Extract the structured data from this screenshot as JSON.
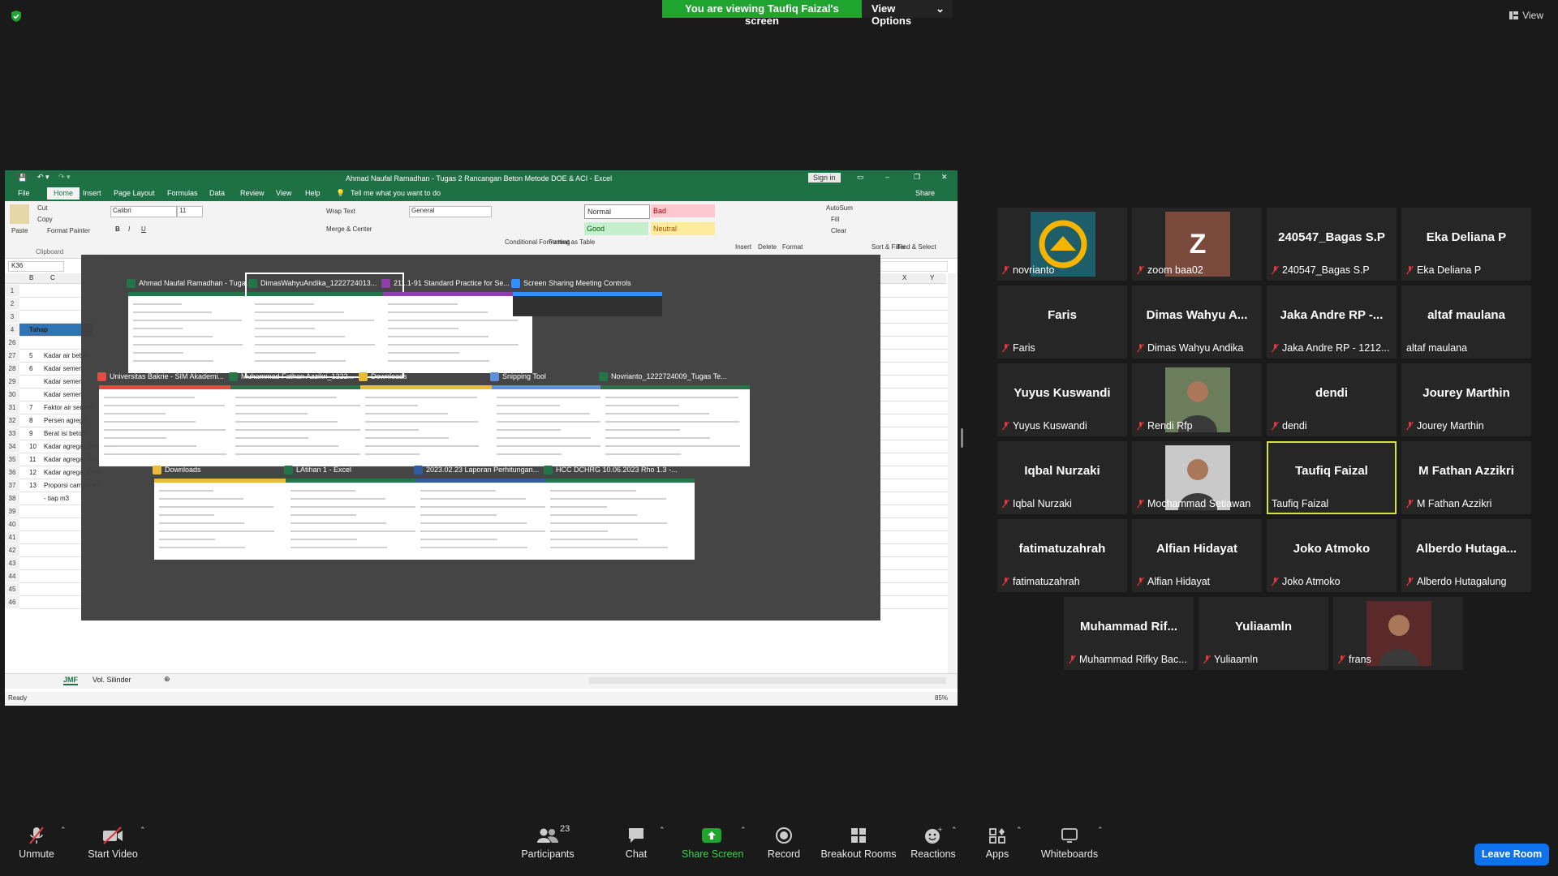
{
  "banner": {
    "viewing": "You are viewing Taufiq Faizal's screen",
    "options": "View Options"
  },
  "view_button": "View",
  "excel": {
    "title": "Ahmad Naufal Ramadhan - Tugas 2 Rancangan Beton Metode DOE & ACI  -  Excel",
    "sign_in": "Sign in",
    "share": "Share",
    "tabs": [
      "File",
      "Home",
      "Insert",
      "Page Layout",
      "Formulas",
      "Data",
      "Review",
      "View",
      "Help"
    ],
    "tell_me": "Tell me what you want to do",
    "ribbon": {
      "paste": "Paste",
      "cut": "Cut",
      "copy": "Copy",
      "format_painter": "Format Painter",
      "clipboard": "Clipboard",
      "font": "Calibri",
      "size": "11",
      "wrap_text": "Wrap Text",
      "merge_center": "Merge & Center",
      "number_format": "General",
      "cond_format": "Conditional Formatting",
      "format_table": "Format as Table",
      "style_normal": "Normal",
      "style_bad": "Bad",
      "style_good": "Good",
      "style_neutral": "Neutral",
      "insert": "Insert",
      "delete": "Delete",
      "format": "Format",
      "autosum": "AutoSum",
      "fill": "Fill",
      "clear": "Clear",
      "sort_filter": "Sort & Filter",
      "find_select": "Find & Select"
    },
    "name_box": "K36",
    "columns": [
      "B",
      "C",
      "X",
      "Y"
    ],
    "rows": [
      {
        "n": "1",
        "b": "",
        "c": ""
      },
      {
        "n": "2",
        "b": "",
        "c": ""
      },
      {
        "n": "3",
        "b": "",
        "c": ""
      },
      {
        "n": "4",
        "b": "Tahap",
        "c": ""
      },
      {
        "n": "26",
        "b": "",
        "c": ""
      },
      {
        "n": "27",
        "b": "5",
        "c": "Kadar air bebas"
      },
      {
        "n": "28",
        "b": "6",
        "c": "Kadar semen"
      },
      {
        "n": "29",
        "b": "",
        "c": "Kadar semen"
      },
      {
        "n": "30",
        "b": "",
        "c": "Kadar semen"
      },
      {
        "n": "31",
        "b": "7",
        "c": "Faktor air semen"
      },
      {
        "n": "32",
        "b": "8",
        "c": "Persen agregat"
      },
      {
        "n": "33",
        "b": "9",
        "c": "Berat isi beton"
      },
      {
        "n": "34",
        "b": "10",
        "c": "Kadar agregat gabungan"
      },
      {
        "n": "35",
        "b": "11",
        "c": "Kadar agregat halus"
      },
      {
        "n": "36",
        "b": "12",
        "c": "Kadar agregat kasar"
      },
      {
        "n": "37",
        "b": "13",
        "c": "Proporsi campuran"
      },
      {
        "n": "38",
        "b": "",
        "c": "- tiap m3"
      },
      {
        "n": "39",
        "b": "",
        "c": ""
      },
      {
        "n": "40",
        "b": "",
        "c": ""
      },
      {
        "n": "41",
        "b": "",
        "c": ""
      },
      {
        "n": "42",
        "b": "",
        "c": ""
      },
      {
        "n": "43",
        "b": "",
        "c": ""
      },
      {
        "n": "44",
        "b": "",
        "c": ""
      },
      {
        "n": "45",
        "b": "",
        "c": ""
      },
      {
        "n": "46",
        "b": "",
        "c": ""
      }
    ],
    "sheet_tabs": [
      "JMF",
      "Vol. Silinder"
    ],
    "status": "Ready",
    "zoom": "85%"
  },
  "switcher": [
    {
      "label": "Ahmad Naufal Ramadhan - Tuga...",
      "icon": "excel-icon",
      "color": "#1e7145"
    },
    {
      "label": "DimasWahyuAndika_1222724013...",
      "icon": "excel-icon",
      "color": "#1e7145"
    },
    {
      "label": "211.1-91 Standard Practice for Se...",
      "icon": "pdf-icon",
      "color": "#8a3aa8"
    },
    {
      "label": "Screen Sharing Meeting Controls",
      "icon": "zoom-icon",
      "color": "#2d8cff"
    },
    {
      "label": "Universitas Bakrie - SIM Akademi...",
      "icon": "chrome-icon",
      "color": "#e8453c"
    },
    {
      "label": "Muhammad Fathan Azzikri_1222...",
      "icon": "excel-icon",
      "color": "#1e7145"
    },
    {
      "label": "Downloads",
      "icon": "folder-icon",
      "color": "#e8b933"
    },
    {
      "label": "Snipping Tool",
      "icon": "snipping-tool-icon",
      "color": "#5a8ddb"
    },
    {
      "label": "Novrianto_1222724009_Tugas Te...",
      "icon": "excel-icon",
      "color": "#1e7145"
    },
    {
      "label": "Downloads",
      "icon": "folder-icon",
      "color": "#e8b933"
    },
    {
      "label": "LAtihan 1 - Excel",
      "icon": "excel-icon",
      "color": "#1e7145"
    },
    {
      "label": "2023.02.23 Laporan Perhitungan...",
      "icon": "word-icon",
      "color": "#2b579a"
    },
    {
      "label": "HCC DCHRG 10.06.2023 Rho 1.3 -...",
      "icon": "excel-icon",
      "color": "#1e7145"
    }
  ],
  "participants": [
    {
      "name": "",
      "label": "novrianto",
      "avatar": "logo"
    },
    {
      "name": "Z",
      "label": "zoom baa02",
      "avatar": "letter"
    },
    {
      "name": "240547_Bagas S.P",
      "label": "240547_Bagas S.P"
    },
    {
      "name": "Eka Deliana P",
      "label": "Eka Deliana P"
    },
    {
      "name": "Faris",
      "label": "Faris"
    },
    {
      "name": "Dimas Wahyu A...",
      "label": "Dimas Wahyu Andika"
    },
    {
      "name": "Jaka Andre RP -...",
      "label": "Jaka Andre RP - 1212..."
    },
    {
      "name": "altaf maulana",
      "label": "altaf maulana"
    },
    {
      "name": "Yuyus Kuswandi",
      "label": "Yuyus Kuswandi"
    },
    {
      "name": "",
      "label": "Rendi Rfp",
      "avatar": "photo"
    },
    {
      "name": "dendi",
      "label": "dendi"
    },
    {
      "name": "Jourey Marthin",
      "label": "Jourey Marthin"
    },
    {
      "name": "Iqbal Nurzaki",
      "label": "Iqbal Nurzaki"
    },
    {
      "name": "",
      "label": "Mochammad Setiawan",
      "avatar": "photo"
    },
    {
      "name": "Taufiq Faizal",
      "label": "Taufiq Faizal"
    },
    {
      "name": "M Fathan Azzikri",
      "label": "M Fathan Azzikri"
    },
    {
      "name": "fatimatuzahrah",
      "label": "fatimatuzahrah"
    },
    {
      "name": "Alfian Hidayat",
      "label": "Alfian Hidayat"
    },
    {
      "name": "Joko Atmoko",
      "label": "Joko Atmoko"
    },
    {
      "name": "Alberdo Hutaga...",
      "label": "Alberdo Hutagalung"
    },
    {
      "name": "Muhammad Rif...",
      "label": "Muhammad Rifky Bac..."
    },
    {
      "name": "Yuliaamln",
      "label": "Yuliaamln"
    },
    {
      "name": "",
      "label": "frans",
      "avatar": "photo"
    }
  ],
  "toolbar": {
    "unmute": "Unmute",
    "start_video": "Start Video",
    "participants": "Participants",
    "participants_count": "23",
    "chat": "Chat",
    "share_screen": "Share Screen",
    "record": "Record",
    "breakout": "Breakout Rooms",
    "reactions": "Reactions",
    "apps": "Apps",
    "whiteboards": "Whiteboards",
    "leave": "Leave Room"
  },
  "colors": {
    "share_green": "#1fa52f",
    "active_speaker": "#d6e33d",
    "leave_blue": "#0e72ed",
    "excel_green": "#1e7145"
  }
}
